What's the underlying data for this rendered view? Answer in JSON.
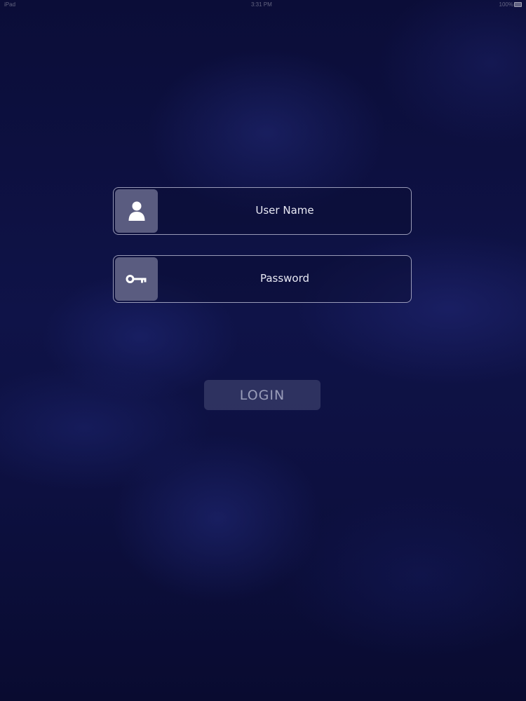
{
  "status_bar": {
    "left_text": "iPad",
    "time": "3:31 PM",
    "battery_text": "100%"
  },
  "login_form": {
    "username": {
      "placeholder": "User Name",
      "value": "",
      "icon": "user-icon"
    },
    "password": {
      "placeholder": "Password",
      "value": "",
      "icon": "key-icon"
    },
    "login_label": "LOGIN"
  },
  "colors": {
    "background": "#0f1348",
    "icon_box": "#5a5c80",
    "field_border": "#c8cae1",
    "button_bg": "#3a3c6a"
  }
}
